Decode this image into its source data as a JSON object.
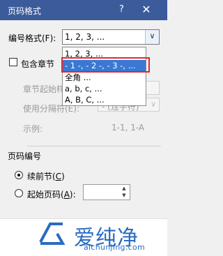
{
  "window": {
    "title": "页码格式",
    "help": "?",
    "close": "✕"
  },
  "number_format": {
    "label": "编号格式(F):",
    "value": "1, 2, 3, ..."
  },
  "dropdown": {
    "options": [
      "1, 2, 3, ...",
      "- 1 -, - 2 -, - 3 -, ...",
      "全角 ...",
      "a, b, c, ...",
      "A, B, C, ..."
    ],
    "selected_index": 1
  },
  "include_chapter": {
    "label": "包含章节"
  },
  "chapter_start": {
    "label": "章节起始样"
  },
  "separator": {
    "label": "使用分隔符(E):",
    "value": "- (连字符)"
  },
  "example": {
    "label": "示例:",
    "value": "1-1, 1-A"
  },
  "page_numbering": {
    "group_label": "页码编号",
    "continue_label": "续前节",
    "continue_key": "C",
    "start_at_label": "起始页码",
    "start_at_key": "A",
    "start_at_value": ""
  },
  "watermark": {
    "brand": "爱纯净",
    "url": "aichunjing.com"
  },
  "colors": {
    "titlebar": "#3c5b9b",
    "selection": "#3a78d4",
    "highlight": "#e0282e",
    "brand": "#2a6bc0"
  },
  "icons": {
    "close": "close-icon",
    "dropdown": "chevron-down-icon",
    "spin_up": "spin-up-icon",
    "spin_down": "spin-down-icon"
  }
}
